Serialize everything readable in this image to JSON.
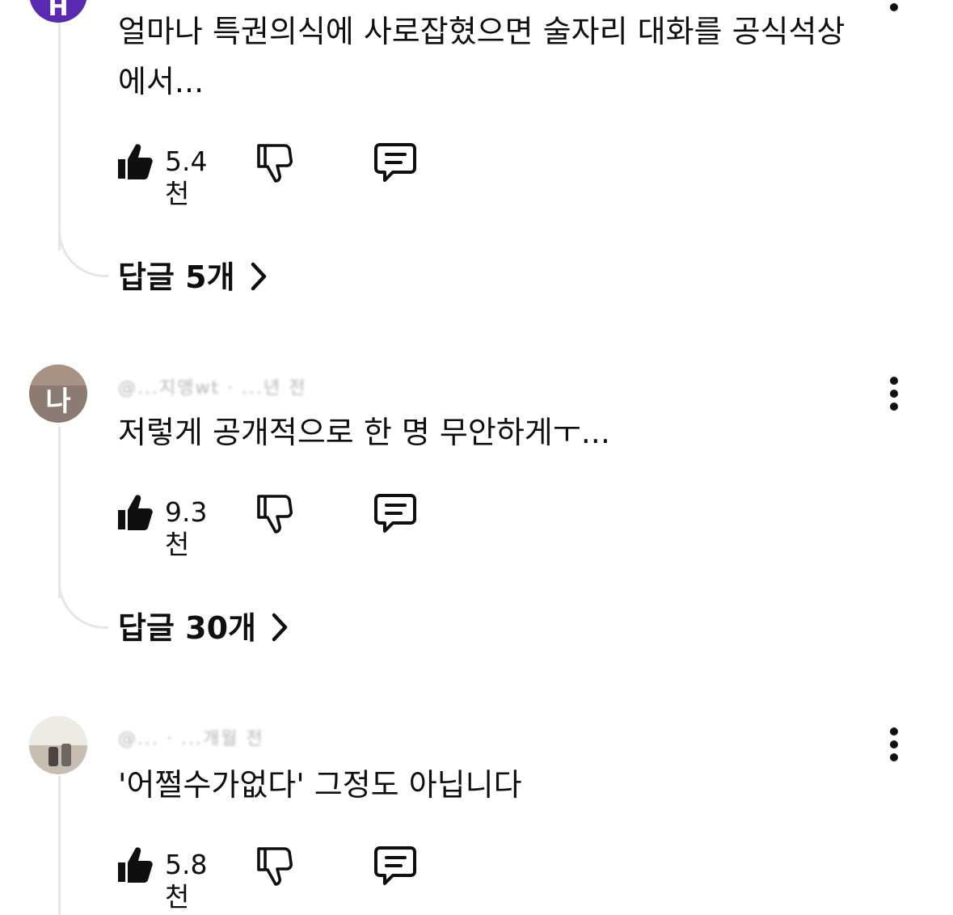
{
  "comments": [
    {
      "avatar_initials": "H",
      "avatar_color": "#5b2ab3",
      "author": "",
      "text": "얼마나 특권의식에 사로잡혔으면 술자리 대화를 공식석상\n에서...",
      "likes": "5.4천",
      "replies_label": "답글 5개"
    },
    {
      "avatar_initials": "나",
      "avatar_color": "#8c7b72",
      "author": "@...지앵wt · ...년 전",
      "text": "저렇게 공개적으로 한 명 무안하게ㅜ...",
      "likes": "9.3천",
      "replies_label": "답글 30개"
    },
    {
      "avatar_initials": "",
      "avatar_color": "#bfb6a8",
      "author": "@... · ...개월 전",
      "text": "'어쩔수가없다' 그정도 아닙니다",
      "likes": "5.8천"
    }
  ],
  "icons": {
    "like": "thumbs-up-icon",
    "dislike": "thumbs-down-icon",
    "reply": "comment-icon",
    "more": "more-vertical-icon",
    "chevron": "chevron-right-icon"
  }
}
